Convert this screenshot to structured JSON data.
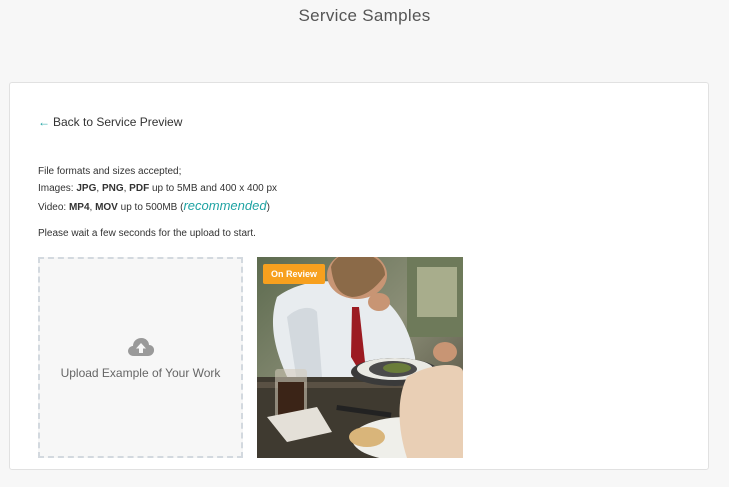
{
  "header": {
    "title": "Service Samples"
  },
  "back": {
    "arrow": "←",
    "label": "Back to Service Preview"
  },
  "info": {
    "line1": "File formats and sizes accepted;",
    "images_prefix": "Images: ",
    "img_jpg": "JPG",
    "sep1": ", ",
    "img_png": "PNG",
    "sep2": ", ",
    "img_pdf": "PDF",
    "images_suffix": " up to 5MB and 400 x 400 px",
    "video_prefix": "Video: ",
    "vid_mp4": "MP4",
    "sep3": ", ",
    "vid_mov": "MOV",
    "video_suffix": " up to 500MB (",
    "recommended": "recommended",
    "close_paren": ")"
  },
  "wait_text": "Please wait a few seconds for the upload to start.",
  "upload": {
    "icon": "cloud-upload-icon",
    "label": "Upload Example of Your Work"
  },
  "sample": {
    "badge": "On Review",
    "status_color": "#f7a01e"
  },
  "colors": {
    "accent": "#1fa3a3"
  }
}
